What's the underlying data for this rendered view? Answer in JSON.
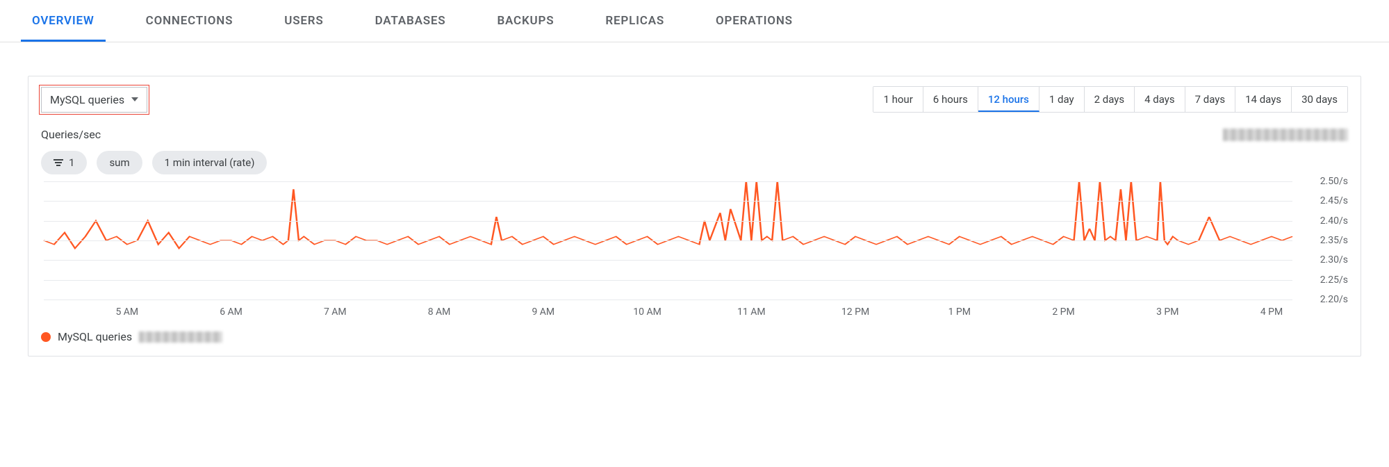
{
  "tabs": [
    {
      "label": "OVERVIEW",
      "active": true
    },
    {
      "label": "CONNECTIONS",
      "active": false
    },
    {
      "label": "USERS",
      "active": false
    },
    {
      "label": "DATABASES",
      "active": false
    },
    {
      "label": "BACKUPS",
      "active": false
    },
    {
      "label": "REPLICAS",
      "active": false
    },
    {
      "label": "OPERATIONS",
      "active": false
    }
  ],
  "metric_dropdown": {
    "selected": "MySQL queries"
  },
  "time_ranges": [
    "1 hour",
    "6 hours",
    "12 hours",
    "1 day",
    "2 days",
    "4 days",
    "7 days",
    "14 days",
    "30 days"
  ],
  "time_range_selected": "12 hours",
  "chart_subtitle": "Queries/sec",
  "chips": {
    "filter_count": "1",
    "agg": "sum",
    "interval": "1 min interval (rate)"
  },
  "legend": {
    "series_name": "MySQL queries"
  },
  "chart_data": {
    "type": "line",
    "title": "",
    "xlabel": "",
    "ylabel": "Queries/sec",
    "ylim": [
      2.2,
      2.5
    ],
    "y_ticks": [
      "2.50/s",
      "2.45/s",
      "2.40/s",
      "2.35/s",
      "2.30/s",
      "2.25/s",
      "2.20/s"
    ],
    "x_ticks": [
      "5 AM",
      "6 AM",
      "7 AM",
      "8 AM",
      "9 AM",
      "10 AM",
      "11 AM",
      "12 PM",
      "1 PM",
      "2 PM",
      "3 PM",
      "4 PM"
    ],
    "x_start_hour": 4.2,
    "x_end_hour": 16.2,
    "series": [
      {
        "name": "MySQL queries",
        "color": "#ff5722",
        "x_hours": [
          4.2,
          4.3,
          4.4,
          4.5,
          4.6,
          4.7,
          4.8,
          4.9,
          5.0,
          5.1,
          5.2,
          5.3,
          5.4,
          5.5,
          5.6,
          5.7,
          5.8,
          5.9,
          6.0,
          6.1,
          6.2,
          6.3,
          6.4,
          6.5,
          6.55,
          6.6,
          6.65,
          6.7,
          6.8,
          6.9,
          7.0,
          7.1,
          7.2,
          7.3,
          7.4,
          7.5,
          7.6,
          7.7,
          7.8,
          7.9,
          8.0,
          8.1,
          8.2,
          8.3,
          8.4,
          8.5,
          8.55,
          8.6,
          8.7,
          8.8,
          8.9,
          9.0,
          9.1,
          9.2,
          9.3,
          9.4,
          9.5,
          9.6,
          9.7,
          9.8,
          9.9,
          10.0,
          10.1,
          10.2,
          10.3,
          10.4,
          10.5,
          10.55,
          10.6,
          10.7,
          10.75,
          10.8,
          10.9,
          10.95,
          11.0,
          11.05,
          11.1,
          11.15,
          11.2,
          11.25,
          11.3,
          11.4,
          11.5,
          11.6,
          11.7,
          11.8,
          11.9,
          12.0,
          12.1,
          12.2,
          12.3,
          12.4,
          12.5,
          12.6,
          12.7,
          12.8,
          12.9,
          13.0,
          13.1,
          13.2,
          13.3,
          13.4,
          13.5,
          13.6,
          13.7,
          13.8,
          13.9,
          14.0,
          14.1,
          14.15,
          14.2,
          14.25,
          14.3,
          14.35,
          14.4,
          14.45,
          14.5,
          14.55,
          14.6,
          14.65,
          14.7,
          14.8,
          14.9,
          14.93,
          14.97,
          15.0,
          15.05,
          15.1,
          15.2,
          15.3,
          15.4,
          15.5,
          15.6,
          15.7,
          15.8,
          15.9,
          16.0,
          16.1,
          16.2
        ],
        "y": [
          2.35,
          2.34,
          2.37,
          2.33,
          2.36,
          2.4,
          2.35,
          2.36,
          2.34,
          2.35,
          2.4,
          2.34,
          2.37,
          2.33,
          2.36,
          2.35,
          2.34,
          2.35,
          2.35,
          2.34,
          2.36,
          2.35,
          2.36,
          2.34,
          2.35,
          2.48,
          2.35,
          2.36,
          2.34,
          2.35,
          2.35,
          2.34,
          2.36,
          2.35,
          2.35,
          2.34,
          2.35,
          2.36,
          2.34,
          2.35,
          2.36,
          2.34,
          2.35,
          2.36,
          2.35,
          2.34,
          2.41,
          2.35,
          2.36,
          2.34,
          2.35,
          2.36,
          2.34,
          2.35,
          2.36,
          2.35,
          2.34,
          2.35,
          2.36,
          2.34,
          2.35,
          2.36,
          2.34,
          2.35,
          2.36,
          2.35,
          2.34,
          2.4,
          2.35,
          2.42,
          2.35,
          2.43,
          2.35,
          2.54,
          2.35,
          2.5,
          2.35,
          2.36,
          2.35,
          2.52,
          2.35,
          2.36,
          2.34,
          2.35,
          2.36,
          2.35,
          2.34,
          2.36,
          2.35,
          2.34,
          2.35,
          2.36,
          2.34,
          2.35,
          2.36,
          2.35,
          2.34,
          2.36,
          2.35,
          2.34,
          2.35,
          2.36,
          2.34,
          2.35,
          2.36,
          2.35,
          2.34,
          2.36,
          2.35,
          2.56,
          2.35,
          2.38,
          2.35,
          2.5,
          2.35,
          2.36,
          2.35,
          2.48,
          2.35,
          2.5,
          2.35,
          2.36,
          2.35,
          2.55,
          2.35,
          2.34,
          2.36,
          2.35,
          2.34,
          2.35,
          2.41,
          2.35,
          2.36,
          2.35,
          2.34,
          2.35,
          2.36,
          2.35,
          2.36
        ]
      }
    ]
  }
}
